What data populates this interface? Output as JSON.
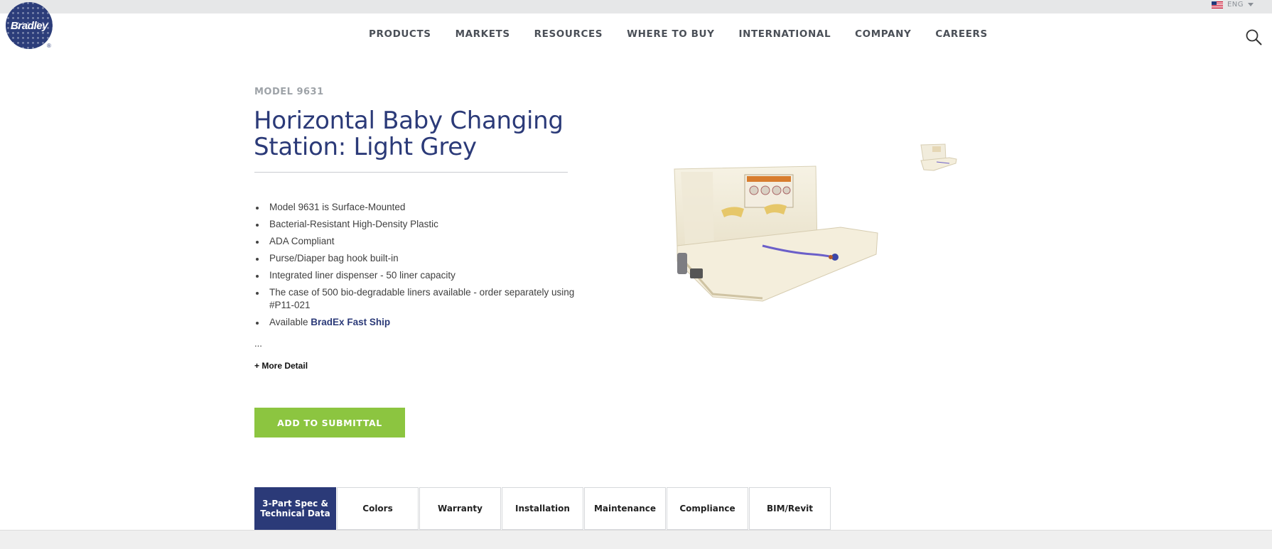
{
  "header": {
    "language": "ENG",
    "logo_text": "Bradley",
    "logo_mark": "®",
    "nav": [
      "PRODUCTS",
      "MARKETS",
      "RESOURCES",
      "WHERE TO BUY",
      "INTERNATIONAL",
      "COMPANY",
      "CAREERS"
    ],
    "icons": {
      "search": "search-icon",
      "flag": "us-flag-icon",
      "caret": "caret-down-icon"
    }
  },
  "product": {
    "model": "MODEL 9631",
    "title": "Horizontal Baby Changing Station: Light Grey",
    "features": [
      "Model 9631 is Surface-Mounted",
      "Bacterial-Resistant High-Density Plastic",
      "ADA Compliant",
      "Purse/Diaper bag hook built-in",
      "Integrated liner dispenser - 50 liner capacity",
      "The case of 500 bio-degradable liners available - order separately using #P11-021"
    ],
    "availability_prefix": "Available ",
    "availability_link": "BradEx Fast Ship",
    "ellipsis": "...",
    "more_detail": "+ More Detail",
    "cta": "ADD TO SUBMITTAL"
  },
  "tabs": [
    {
      "label": "3-Part Spec & Technical Data",
      "active": true
    },
    {
      "label": "Colors",
      "active": false
    },
    {
      "label": "Warranty",
      "active": false
    },
    {
      "label": "Installation",
      "active": false
    },
    {
      "label": "Maintenance",
      "active": false
    },
    {
      "label": "Compliance",
      "active": false
    },
    {
      "label": "BIM/Revit",
      "active": false
    }
  ],
  "colors": {
    "brand_navy": "#2b3a78",
    "cta_green": "#8cc540",
    "topbar_grey": "#e6e7e8"
  }
}
